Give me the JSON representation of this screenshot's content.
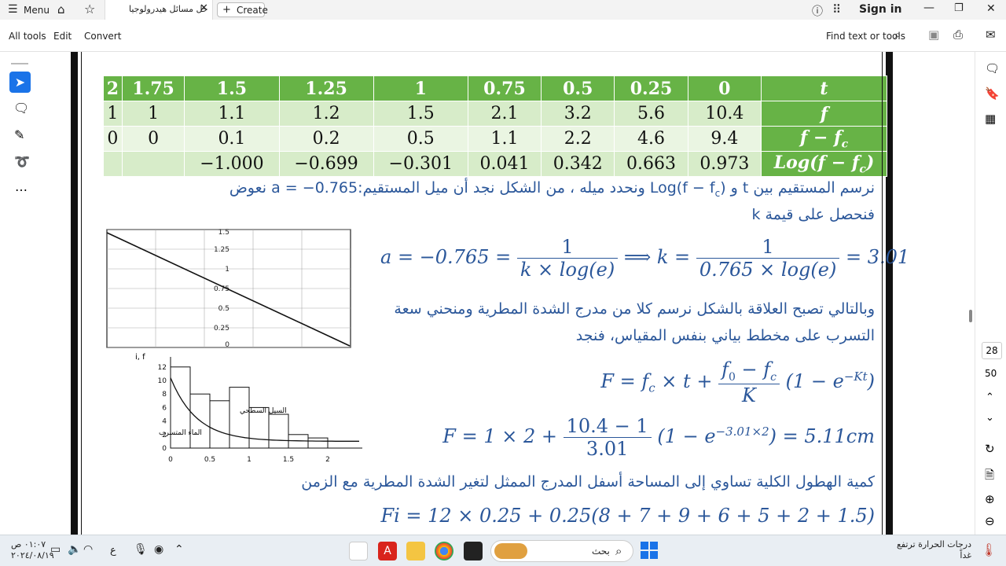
{
  "titlebar": {
    "menu_label": "Menu",
    "tab_title": "حل مسائل هيدرولوجيا",
    "create_label": "Create",
    "sign_in": "Sign in"
  },
  "toolbar": {
    "all_tools": "All tools",
    "edit": "Edit",
    "convert": "Convert",
    "find": "Find text or tools"
  },
  "rightrail": {
    "page_current": "28",
    "page_total": "50"
  },
  "doc": {
    "table": {
      "rows": [
        [
          "2",
          "1.75",
          "1.5",
          "1.25",
          "1",
          "0.75",
          "0.5",
          "0.25",
          "0"
        ],
        [
          "1",
          "1",
          "1.1",
          "1.2",
          "1.5",
          "2.1",
          "3.2",
          "5.6",
          "10.4"
        ],
        [
          "0",
          "0",
          "0.1",
          "0.2",
          "0.5",
          "1.1",
          "2.2",
          "4.6",
          "9.4"
        ],
        [
          "",
          "",
          "−1.000",
          "−0.699",
          "−0.301",
          "0.041",
          "0.342",
          "0.663",
          "0.973"
        ]
      ],
      "headers": [
        "t",
        "f",
        "f − f",
        "Log(f − f"
      ],
      "header_subs": [
        "",
        "",
        "c",
        "c"
      ],
      "header_tails": [
        "",
        "",
        "",
        ")"
      ]
    },
    "para1_ar": "نرسم المستقيم بين  t و  (Log(f − f",
    "para1_sub": "c",
    "para1_rest": "  ونحدد ميله ، من الشكل نجد أن ميل المستقيم:0.765− = a  نعوض",
    "para2_ar": "فنحصل على قيمة k",
    "eq1_left": "a = −0.765 =",
    "eq1_num": "1",
    "eq1_den": "k × log(e)",
    "eq1_mid": "⟹ k =",
    "eq1_num2": "1",
    "eq1_den2": "0.765 × log(e)",
    "eq1_right": "= 3.01",
    "para3_ar": "وبالتالي تصبح العلاقة بالشكل نرسم كلا من مدرج الشدة المطرية ومنحني سعة",
    "para4_ar": "التسرب على مخطط بياني بنفس المقياس، فنجد",
    "eq2_left": "F = f",
    "eq2_mid": " × t +",
    "eq2_num": "f",
    "eq2_num_b": " − f",
    "eq2_den": "K",
    "eq2_right": "(1 − e",
    "eq2_exp": "−Kt",
    "eq2_close": ")",
    "eq3_left": "F = 1 × 2 +",
    "eq3_num": "10.4 − 1",
    "eq3_den": "3.01",
    "eq3_right": "(1 − e",
    "eq3_exp": "−3.01×2",
    "eq3_close": ") = 5.11cm",
    "para5_ar": "كمية الهطول الكلية تساوي إلى المساحة أسفل المدرج الممثل لتغير الشدة المطرية مع الزمن",
    "eq4": "Fi  = 12 × 0.25 +  0.25(8 + 7 + 9 + 6 +  5 + 2 + 1.5)"
  },
  "plot1": {
    "yticks": [
      "1.5",
      "1.25",
      "1",
      "0.75",
      "0.5",
      "0.25",
      "0"
    ]
  },
  "plot2": {
    "ylabel": "i, f",
    "yticks": [
      "12",
      "10",
      "8",
      "6",
      "4",
      "2",
      "0"
    ],
    "xticks": [
      "0",
      "0.5",
      "1",
      "1.5",
      "2"
    ],
    "label_runoff": "السيل السطحي",
    "label_infiltration": "الماء المتسرب",
    "bars": [
      12,
      8,
      7,
      9,
      6,
      5,
      2,
      1.5
    ],
    "bar_width": 0.25
  },
  "taskbar": {
    "search": "بحث",
    "weather_line1": "درجات الحرارة ترتفع",
    "weather_line2": "غداً",
    "time": "٠١:٠٧ ص",
    "date": "٢٠٢٤/٠٨/١٩",
    "lang": "ع"
  }
}
